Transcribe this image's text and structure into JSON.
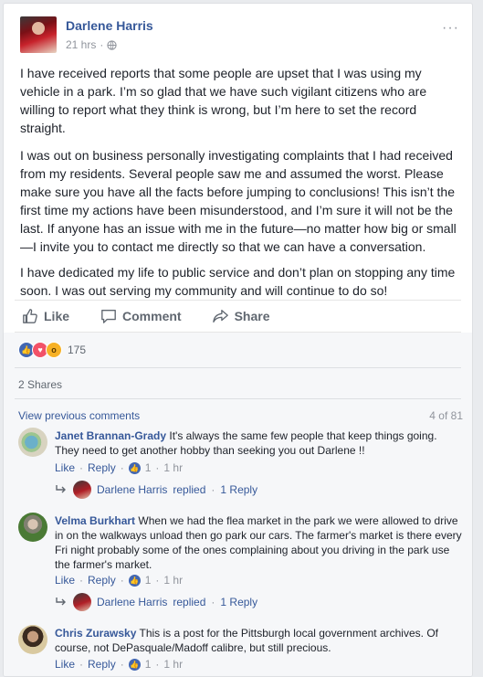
{
  "post": {
    "author": "Darlene Harris",
    "time": "21 hrs",
    "sep": "·",
    "menu": "···",
    "paragraphs": [
      "I have received reports that some people are upset that I was using my vehicle in a park. I’m so glad that we have such vigilant citizens who are willing to report what they think is wrong, but I’m here to set the record straight.",
      "I was out on business personally investigating complaints that I had received from my residents. Several people saw me and assumed the worst. Please make sure you have all the facts before jumping to conclusions! This isn’t the first time my actions have been misunderstood, and I’m sure it will not be the last. If anyone has an issue with me in the future—no matter how big or small—I invite you to contact me directly so that we can have a conversation.",
      "I have dedicated my life to public service and don’t plan on stopping any time soon. I was out serving my community and will continue to do so!"
    ]
  },
  "actions": {
    "like": "Like",
    "comment": "Comment",
    "share": "Share"
  },
  "reactions": {
    "count": "175"
  },
  "shares": "2 Shares",
  "comments_header": {
    "view_previous": "View previous comments",
    "count": "4 of 81"
  },
  "comments": [
    {
      "name": "Janet Brannan-Grady",
      "text": "It's always the same few people that keep things going. They need to get another hobby than seeking you out Darlene !!",
      "like": "Like",
      "reply": "Reply",
      "likes": "1",
      "time": "1 hr",
      "replied_name": "Darlene Harris",
      "replied_word": "replied",
      "reply_count": "1 Reply"
    },
    {
      "name": "Velma Burkhart",
      "text": "When we had the flea market in the park we were allowed to drive in on the walkways unload then go park our cars. The farmer's market is there every Fri night probably some of the ones complaining about you driving in the park use the farmer's market.",
      "like": "Like",
      "reply": "Reply",
      "likes": "1",
      "time": "1 hr",
      "replied_name": "Darlene Harris",
      "replied_word": "replied",
      "reply_count": "1 Reply"
    },
    {
      "name": "Chris Zurawsky",
      "text": "This is a post for the Pittsburgh local government archives. Of course, not DePasquale/Madoff calibre, but still precious.",
      "like": "Like",
      "reply": "Reply",
      "likes": "1",
      "time": "1 hr"
    }
  ],
  "dot": "·",
  "colors": {
    "link": "#365899",
    "like_blue": "#4267b2",
    "muted": "#90949c"
  }
}
